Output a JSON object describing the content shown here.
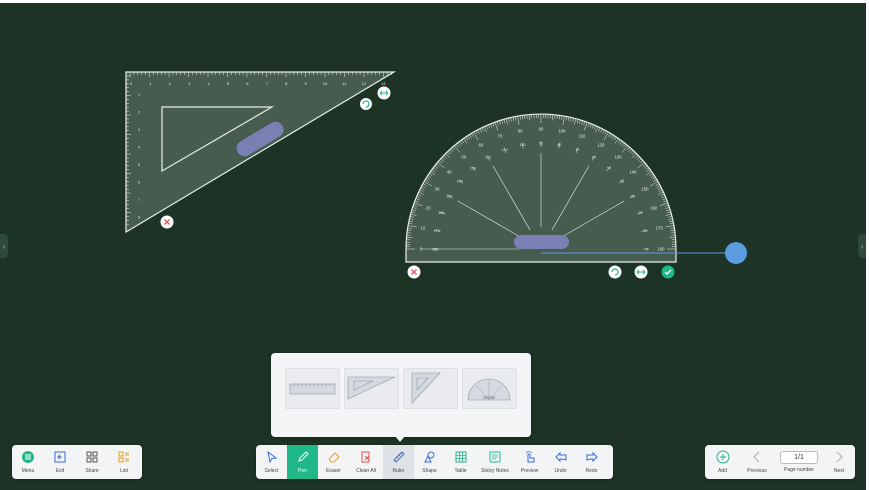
{
  "left_toolbar": [
    {
      "label": "Menu",
      "icon": "menu-icon"
    },
    {
      "label": "Exit",
      "icon": "exit-icon"
    },
    {
      "label": "Share",
      "icon": "share-icon"
    },
    {
      "label": "List",
      "icon": "list-icon"
    }
  ],
  "main_toolbar": [
    {
      "label": "Select",
      "icon": "cursor-icon",
      "state": "normal"
    },
    {
      "label": "Pen",
      "icon": "pen-icon",
      "state": "active"
    },
    {
      "label": "Eraser",
      "icon": "eraser-icon",
      "state": "normal"
    },
    {
      "label": "Clean All",
      "icon": "clean-all-icon",
      "state": "normal"
    },
    {
      "label": "Ruler",
      "icon": "ruler-icon",
      "state": "highlighted"
    },
    {
      "label": "Shape",
      "icon": "shape-icon",
      "state": "normal"
    },
    {
      "label": "Table",
      "icon": "table-icon",
      "state": "normal"
    },
    {
      "label": "Sticky Notes",
      "icon": "sticky-note-icon",
      "state": "normal"
    },
    {
      "label": "Preview",
      "icon": "preview-icon",
      "state": "normal"
    },
    {
      "label": "Undo",
      "icon": "undo-icon",
      "state": "normal"
    },
    {
      "label": "Redo",
      "icon": "redo-icon",
      "state": "normal"
    }
  ],
  "right_toolbar": {
    "add_label": "Add",
    "previous_label": "Previous",
    "page_number_label": "Page number",
    "page_value": "1/1",
    "next_label": "Next"
  },
  "ruler_menu": [
    "straight-ruler",
    "triangle-ruler-30-60",
    "triangle-ruler-45",
    "protractor"
  ],
  "triangle_ruler": {
    "ticks": [
      "0",
      "1",
      "2",
      "3",
      "4",
      "5",
      "6",
      "7",
      "8",
      "9",
      "10",
      "11",
      "12",
      "13"
    ],
    "side_ticks": [
      "1",
      "2",
      "3",
      "4",
      "5",
      "6",
      "7",
      "8"
    ]
  },
  "protractor": {
    "outer_labels": [
      "0",
      "10",
      "20",
      "30",
      "40",
      "50",
      "60",
      "70",
      "80",
      "90",
      "100",
      "110",
      "120",
      "130",
      "140",
      "150",
      "160",
      "170",
      "180"
    ],
    "inner_labels": [
      "180",
      "170",
      "160",
      "150",
      "140",
      "130",
      "120",
      "110",
      "100",
      "90",
      "80",
      "70",
      "60",
      "50",
      "40",
      "30",
      "20",
      "10",
      "0"
    ]
  },
  "colors": {
    "board": "#1d3325",
    "accent": "#21b889",
    "handle": "#7b80b3",
    "dot": "#5b9be0",
    "close": "#e05555"
  }
}
